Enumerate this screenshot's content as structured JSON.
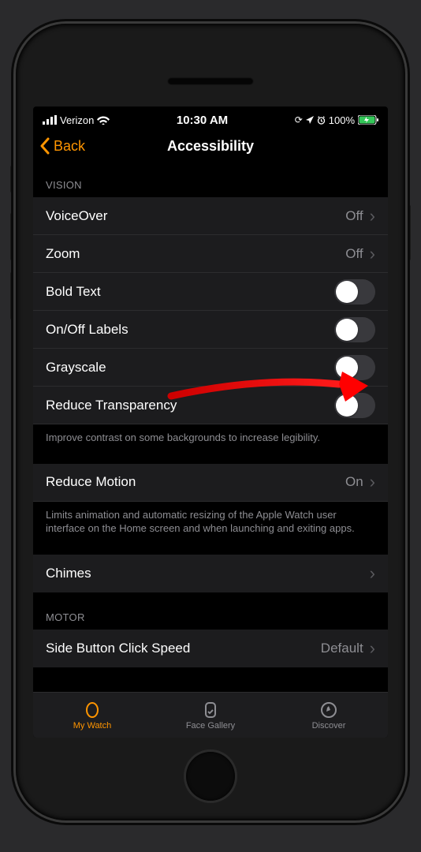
{
  "statusbar": {
    "carrier": "Verizon",
    "time": "10:30 AM",
    "battery_pct": "100%"
  },
  "nav": {
    "back_label": "Back",
    "title": "Accessibility"
  },
  "sections": {
    "vision_header": "VISION",
    "motor_header": "MOTOR"
  },
  "rows": {
    "voiceover": {
      "label": "VoiceOver",
      "value": "Off"
    },
    "zoom": {
      "label": "Zoom",
      "value": "Off"
    },
    "boldtext": {
      "label": "Bold Text"
    },
    "onoff": {
      "label": "On/Off Labels"
    },
    "grayscale": {
      "label": "Grayscale"
    },
    "reduce_trans": {
      "label": "Reduce Transparency"
    },
    "reduce_motion": {
      "label": "Reduce Motion",
      "value": "On"
    },
    "chimes": {
      "label": "Chimes"
    },
    "side_click": {
      "label": "Side Button Click Speed",
      "value": "Default"
    }
  },
  "notes": {
    "trans": "Improve contrast on some backgrounds to increase legibility.",
    "motion": "Limits animation and automatic resizing of the Apple Watch user interface on the Home screen and when launching and exiting apps."
  },
  "tabs": {
    "mywatch": "My Watch",
    "facegallery": "Face Gallery",
    "discover": "Discover"
  }
}
